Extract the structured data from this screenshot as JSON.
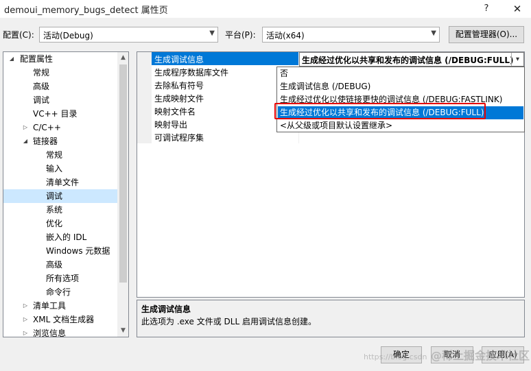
{
  "window": {
    "title": "demoui_memory_bugs_detect 属性页",
    "help": "?",
    "close": "✕"
  },
  "config": {
    "label": "配置(C):",
    "value": "活动(Debug)",
    "platform_label": "平台(P):",
    "platform_value": "活动(x64)",
    "manager_button": "配置管理器(O)..."
  },
  "tree": {
    "items": [
      {
        "label": "配置属性",
        "expander": "◢"
      },
      {
        "label": "常规",
        "expander": ""
      },
      {
        "label": "高级",
        "expander": ""
      },
      {
        "label": "调试",
        "expander": ""
      },
      {
        "label": "VC++ 目录",
        "expander": ""
      },
      {
        "label": "C/C++",
        "expander": "▷"
      },
      {
        "label": "链接器",
        "expander": "◢"
      },
      {
        "label": "常规",
        "expander": ""
      },
      {
        "label": "输入",
        "expander": ""
      },
      {
        "label": "清单文件",
        "expander": ""
      },
      {
        "label": "调试",
        "expander": ""
      },
      {
        "label": "系统",
        "expander": ""
      },
      {
        "label": "优化",
        "expander": ""
      },
      {
        "label": "嵌入的 IDL",
        "expander": ""
      },
      {
        "label": "Windows 元数据",
        "expander": ""
      },
      {
        "label": "高级",
        "expander": ""
      },
      {
        "label": "所有选项",
        "expander": ""
      },
      {
        "label": "命令行",
        "expander": ""
      },
      {
        "label": "清单工具",
        "expander": "▷"
      },
      {
        "label": "XML 文档生成器",
        "expander": "▷"
      },
      {
        "label": "浏览信息",
        "expander": "▷"
      }
    ],
    "scroll_up": "▲",
    "scroll_down": "▼"
  },
  "grid": {
    "properties": [
      "生成调试信息",
      "生成程序数据库文件",
      "去除私有符号",
      "生成映射文件",
      "映射文件名",
      "映射导出",
      "可调试程序集"
    ],
    "current_value": "生成经过优化以共享和发布的调试信息 (/DEBUG:FULL)",
    "dropdown_arrow": "▾"
  },
  "dropdown": {
    "options": [
      "否",
      "生成调试信息 (/DEBUG)",
      "生成经过优化以使链接更快的调试信息 (/DEBUG:FASTLINK)",
      "生成经过优化以共享和发布的调试信息 (/DEBUG:FULL)",
      "<从父级或项目默认设置继承>"
    ]
  },
  "description": {
    "title": "生成调试信息",
    "text": "此选项为 .exe 文件或 DLL 启用调试信息创建。"
  },
  "buttons": {
    "ok": "确定",
    "cancel": "取消",
    "apply": "应用(A)"
  },
  "watermark": {
    "text": "@稀土掘金技术社区",
    "url": "https://blog.csdn"
  }
}
